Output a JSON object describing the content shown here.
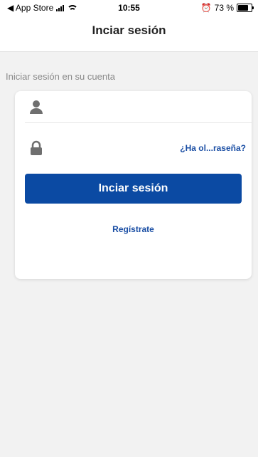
{
  "status_bar": {
    "back_app": "◀ App Store",
    "time": "10:55",
    "battery_percent": "73 %"
  },
  "nav": {
    "title": "Inciar sesión"
  },
  "form": {
    "section_label": "Iniciar sesión en su cuenta",
    "username": {
      "icon": "user-icon",
      "value": "",
      "placeholder": ""
    },
    "password": {
      "icon": "lock-icon",
      "value": "",
      "placeholder": "",
      "forgot_link": "¿Ha ol...raseña?"
    },
    "login_button": "Inciar sesión",
    "register_link": "Regístrate"
  },
  "colors": {
    "primary": "#0b4aa3",
    "link": "#1a4ea4",
    "background": "#f2f2f2"
  }
}
